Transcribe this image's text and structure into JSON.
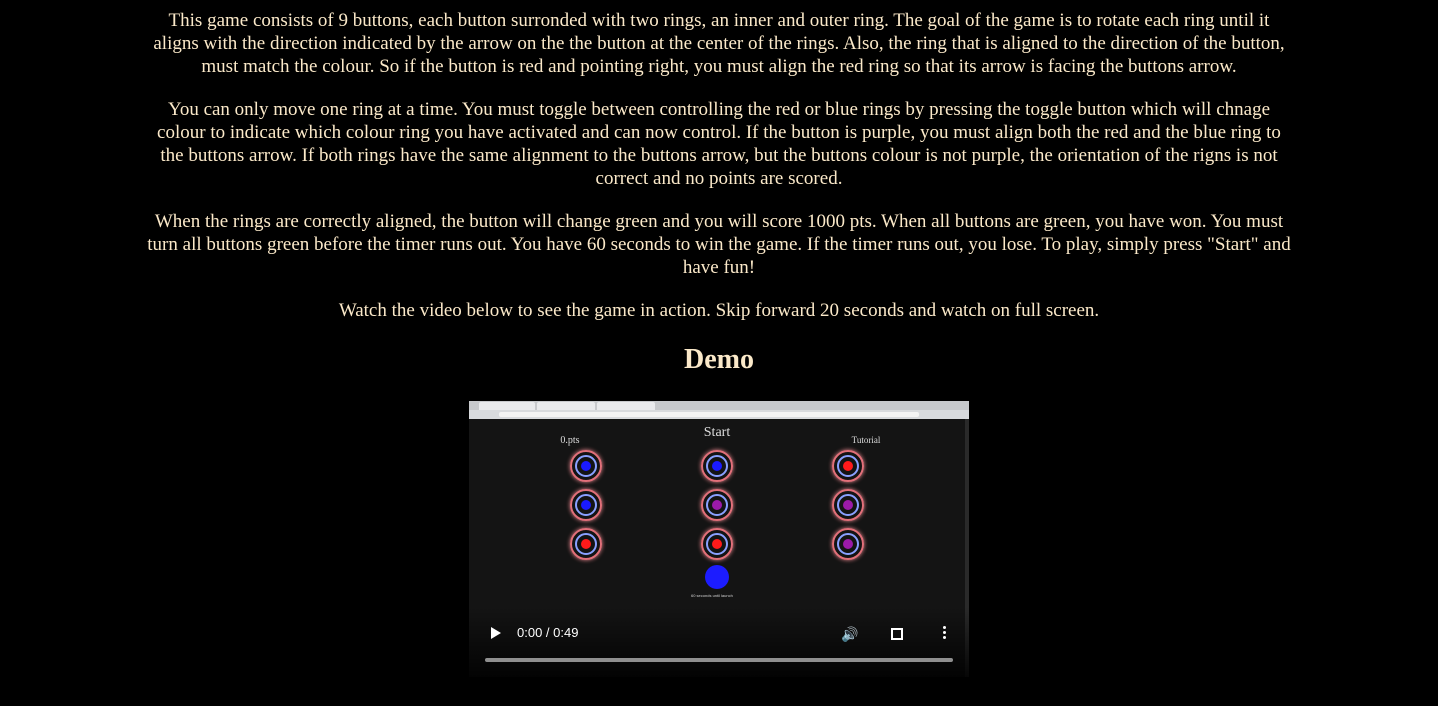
{
  "intro": {
    "paragraph_1": "This game consists of 9 buttons, each button surronded with two rings, an inner and outer ring. The goal of the game is to rotate each ring until it aligns with the direction indicated by the arrow on the the button at the center of the rings. Also, the ring that is aligned to the direction of the button, must match the colour. So if the button is red and pointing right, you must align the red ring so that its arrow is facing the buttons arrow.",
    "paragraph_2": "You can only move one ring at a time. You must toggle between controlling the red or blue rings by pressing the toggle button which will chnage colour to indicate which colour ring you have activated and can now control. If the button is purple, you must align both the red and the blue ring to the buttons arrow. If both rings have the same alignment to the buttons arrow, but the buttons colour is not purple, the orientation of the rigns is not correct and no points are scored.",
    "paragraph_3": "When the rings are correctly aligned, the button will change green and you will score 1000 pts. When all buttons are green, you have won. You must turn all buttons green before the timer runs out. You have 60 seconds to win the game. If the timer runs out, you lose. To play, simply press \"Start\" and have fun!",
    "paragraph_4": "Watch the video below to see the game in action. Skip forward 20 seconds and watch on full screen."
  },
  "demo": {
    "heading": "Demo"
  },
  "video": {
    "time_display": "0:00 / 0:49",
    "progress_fraction": 0,
    "icons": {
      "play": "play-icon",
      "mute": "volume-icon",
      "fullscreen": "fullscreen-icon",
      "more": "more-vert-icon"
    },
    "frame": {
      "score": "0.pts",
      "start": "Start",
      "tutorial": "Tutorial",
      "countdown": "60 seconds until launch",
      "toggle_color": "#1c1cff",
      "button_colors": [
        [
          "#1a1aff",
          "#1a1aff",
          "#ff1a1a"
        ],
        [
          "#1a1aff",
          "#9b1aa8",
          "#9b1aa8"
        ],
        [
          "#ff1a1a",
          "#ff1a1a",
          "#9b1aa8"
        ]
      ]
    }
  },
  "colors": {
    "background": "#000000",
    "text": "#fbe9c9"
  }
}
